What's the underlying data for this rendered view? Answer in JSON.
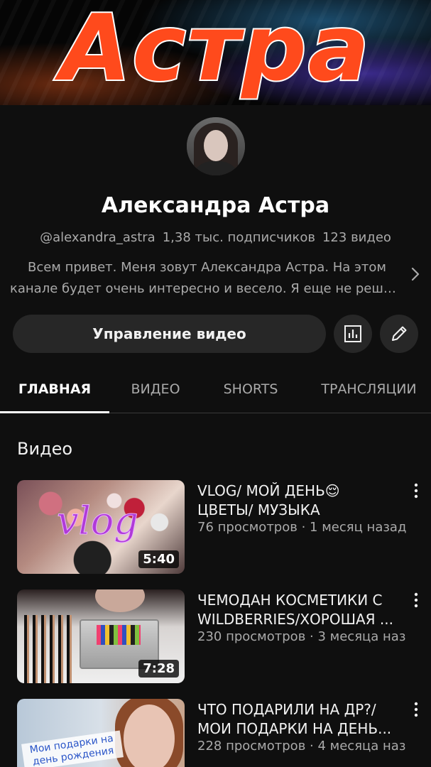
{
  "banner": {
    "title": "Астра"
  },
  "channel": {
    "name": "Александра Астра",
    "handle": "@alexandra_astra",
    "subscribers": "1,38 тыс. подписчиков",
    "videos_count": "123 видео",
    "description_line1": "Всем привет. Меня зовут Александра Астра. На этом",
    "description_line2": "канале будет очень интересно и весело. Я еще не решил..."
  },
  "actions": {
    "manage_label": "Управление видео",
    "analytics_icon": "analytics-icon",
    "edit_icon": "pencil-icon"
  },
  "tabs": [
    {
      "label": "ГЛАВНАЯ",
      "active": true
    },
    {
      "label": "ВИДЕО",
      "active": false
    },
    {
      "label": "SHORTS",
      "active": false
    },
    {
      "label": "ТРАНСЛЯЦИИ",
      "active": false
    }
  ],
  "section": {
    "title": "Видео"
  },
  "videos": [
    {
      "title_line1": "VLOG/ МОЙ ДЕНЬ😌",
      "title_line2": "ЦВЕТЫ/ МУЗЫКА",
      "meta": "76 просмотров · 1 месяц назад",
      "duration": "5:40",
      "thumb_text": "vlog"
    },
    {
      "title_line1": "ЧЕМОДАН КОСМЕТИКИ С",
      "title_line2": "WILDBERRIES/ХОРОШАЯ ...",
      "meta": "230 просмотров · 3 месяца наз",
      "duration": "7:28"
    },
    {
      "title_line1": "ЧТО ПОДАРИЛИ НА ДР?/",
      "title_line2": "МОИ ПОДАРКИ НА ДЕНЬ...",
      "meta": "228 просмотров · 4 месяца наз",
      "thumb_text": "Мои подарки на день рождения"
    }
  ],
  "colors": {
    "background": "#0f0f0f",
    "button": "#272727",
    "banner_text": "#ff4a1c",
    "secondary_text": "#aaaaaa"
  }
}
